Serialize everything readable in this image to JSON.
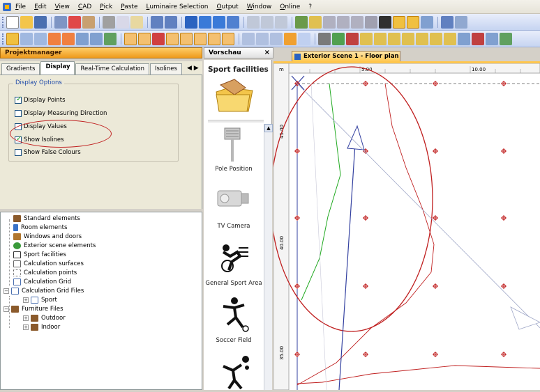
{
  "menu": [
    "File",
    "Edit",
    "View",
    "CAD",
    "Pick",
    "Paste",
    "Luminaire Selection",
    "Output",
    "Window",
    "Online",
    "?"
  ],
  "left_panel": {
    "title": "Projektmanager",
    "tabs": [
      "Gradients",
      "Display",
      "Real-Time Calculation",
      "Isolines"
    ],
    "active_tab": "Display",
    "tab_arrows": "◀ ▶",
    "group_title": "Display Options",
    "options": [
      {
        "label": "Display Points",
        "checked": true
      },
      {
        "label": "Display Measuring Direction",
        "checked": false
      },
      {
        "label": "Display Values",
        "checked": false
      },
      {
        "label": "Show Isolines",
        "checked": true
      },
      {
        "label": "Show False Colours",
        "checked": false
      }
    ]
  },
  "tree": {
    "items": [
      {
        "label": "Standard elements",
        "icon": "furniture-icon",
        "color": "#8b5a2b"
      },
      {
        "label": "Room elements",
        "icon": "room-icon",
        "color": "#3a73c8"
      },
      {
        "label": "Windows and doors",
        "icon": "window-icon",
        "color": "#b0762e"
      },
      {
        "label": "Exterior scene elements",
        "icon": "exterior-icon",
        "color": "#3a9a3a"
      },
      {
        "label": "Sport facilities",
        "icon": "sport-icon",
        "color": "#333333"
      },
      {
        "label": "Calculation surfaces",
        "icon": "calc-surface-icon",
        "color": "#666666"
      },
      {
        "label": "Calculation points",
        "icon": "calc-points-icon",
        "color": "#666666"
      },
      {
        "label": "Calculation Grid",
        "icon": "calc-grid-icon",
        "color": "#4a6fb0"
      },
      {
        "label": "Calculation Grid Files",
        "icon": "calc-grid-icon",
        "color": "#4a6fb0"
      },
      {
        "label": "Sport",
        "icon": "calc-grid-icon",
        "color": "#4a6fb0"
      },
      {
        "label": "Furniture Files",
        "icon": "furniture-icon",
        "color": "#8b5a2b"
      },
      {
        "label": "Outdoor",
        "icon": "furniture-icon",
        "color": "#8b5a2b"
      },
      {
        "label": "Indoor",
        "icon": "furniture-icon",
        "color": "#8b5a2b"
      }
    ]
  },
  "preview": {
    "header": "Vorschau",
    "close": "×",
    "title": "Sport facilities",
    "items": [
      "Pole Position",
      "TV Camera",
      "General Sport Area",
      "Soccer Field"
    ]
  },
  "document": {
    "tab_title": "Exterior Scene 1 - Floor plan",
    "ruler_unit": "m",
    "ruler_top": [
      "5.00",
      "10.00"
    ],
    "ruler_left": [
      "45.00",
      "40.00",
      "35.00"
    ]
  },
  "colors": {
    "accent_orange": "#ffc64d",
    "isoline_red": "#c02020",
    "isoline_green": "#22aa22",
    "arrow_blue": "#3340a0"
  }
}
